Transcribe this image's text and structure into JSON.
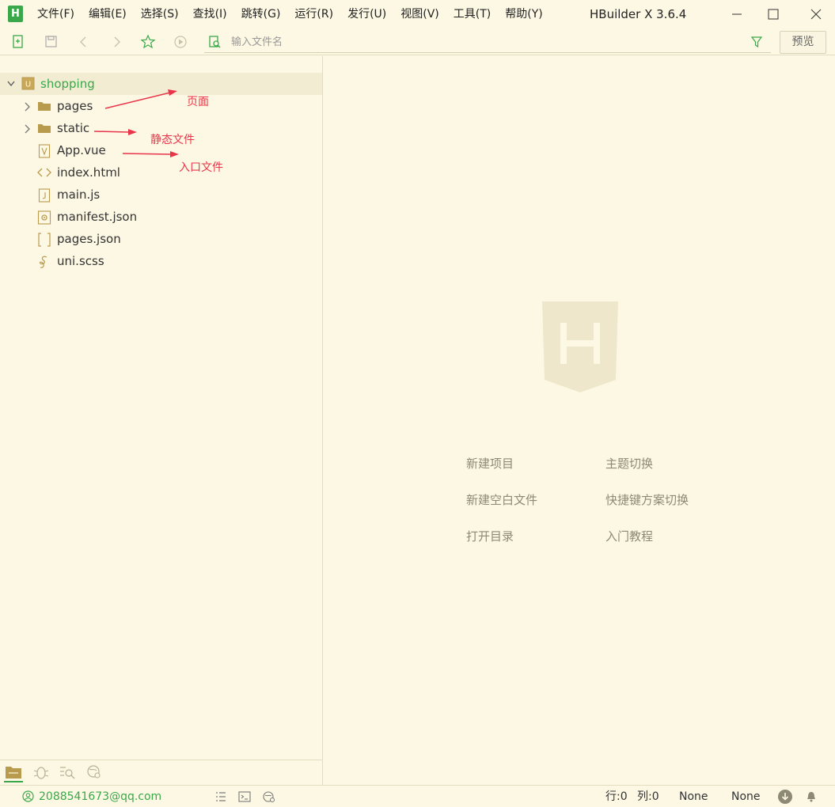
{
  "app": {
    "logo_text": "H",
    "title": "HBuilder X 3.6.4"
  },
  "menu": [
    "文件(F)",
    "编辑(E)",
    "选择(S)",
    "查找(I)",
    "跳转(G)",
    "运行(R)",
    "发行(U)",
    "视图(V)",
    "工具(T)",
    "帮助(Y)"
  ],
  "toolbar": {
    "search_placeholder": "输入文件名",
    "preview_label": "预览"
  },
  "tree": {
    "root": "shopping",
    "items": [
      {
        "label": "pages",
        "icon": "folder-icon"
      },
      {
        "label": "static",
        "icon": "folder-icon"
      },
      {
        "label": "App.vue",
        "icon": "vue-file-icon"
      },
      {
        "label": "index.html",
        "icon": "html-file-icon"
      },
      {
        "label": "main.js",
        "icon": "js-file-icon"
      },
      {
        "label": "manifest.json",
        "icon": "manifest-file-icon"
      },
      {
        "label": "pages.json",
        "icon": "json-file-icon"
      },
      {
        "label": "uni.scss",
        "icon": "scss-file-icon"
      }
    ]
  },
  "annotations": [
    "页面",
    "静态文件",
    "入口文件"
  ],
  "welcome": {
    "links": [
      "新建项目",
      "主题切换",
      "新建空白文件",
      "快捷键方案切换",
      "打开目录",
      "入门教程"
    ]
  },
  "status": {
    "user": "2088541673@qq.com",
    "row": "行:0",
    "col": "列:0",
    "encoding": "None",
    "syntax": "None"
  },
  "colors": {
    "background": "#fdf8e4",
    "accent": "#3aa84a",
    "annotation": "#e8354a",
    "folder": "#b99b4e"
  }
}
